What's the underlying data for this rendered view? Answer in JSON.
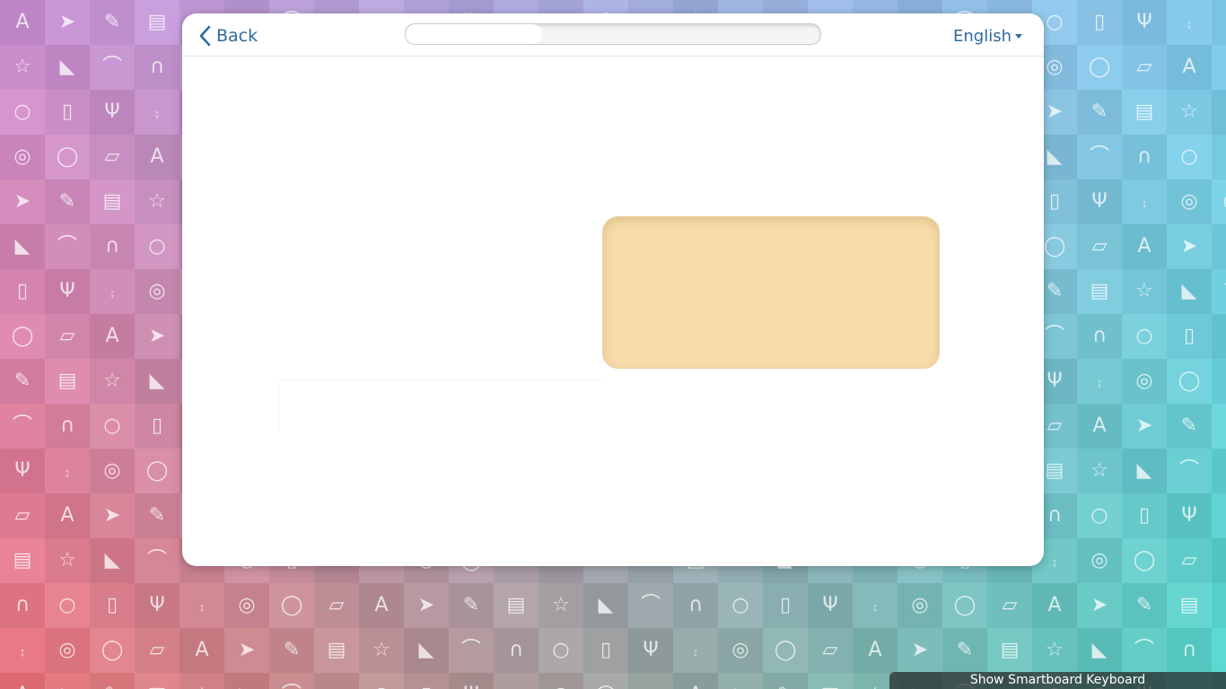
{
  "header": {
    "back_label": "Back",
    "progress_fraction": 0.33,
    "language": "English"
  },
  "footer": {
    "keyboard_button_label": "Show Smartboard Keyboard"
  },
  "background": {
    "tile_icons": [
      "letter-a-icon",
      "paper-plane-icon",
      "pencil-icon",
      "briefcase-icon",
      "star-icon",
      "sneaker-icon",
      "wifi-icon",
      "headphones-icon",
      "globe-icon",
      "music-player-icon",
      "slingshot-icon",
      "skateboard-icon",
      "apple-icon",
      "circle-icon",
      "book-icon"
    ],
    "colors": {
      "top_left": "#c88fd0",
      "bottom_left": "#e6737a",
      "top_right": "#7fc8e8",
      "bottom_right": "#4fd0c4"
    }
  },
  "colors": {
    "accent": "#2d6a9f",
    "answer_box": "#f7dca9"
  }
}
